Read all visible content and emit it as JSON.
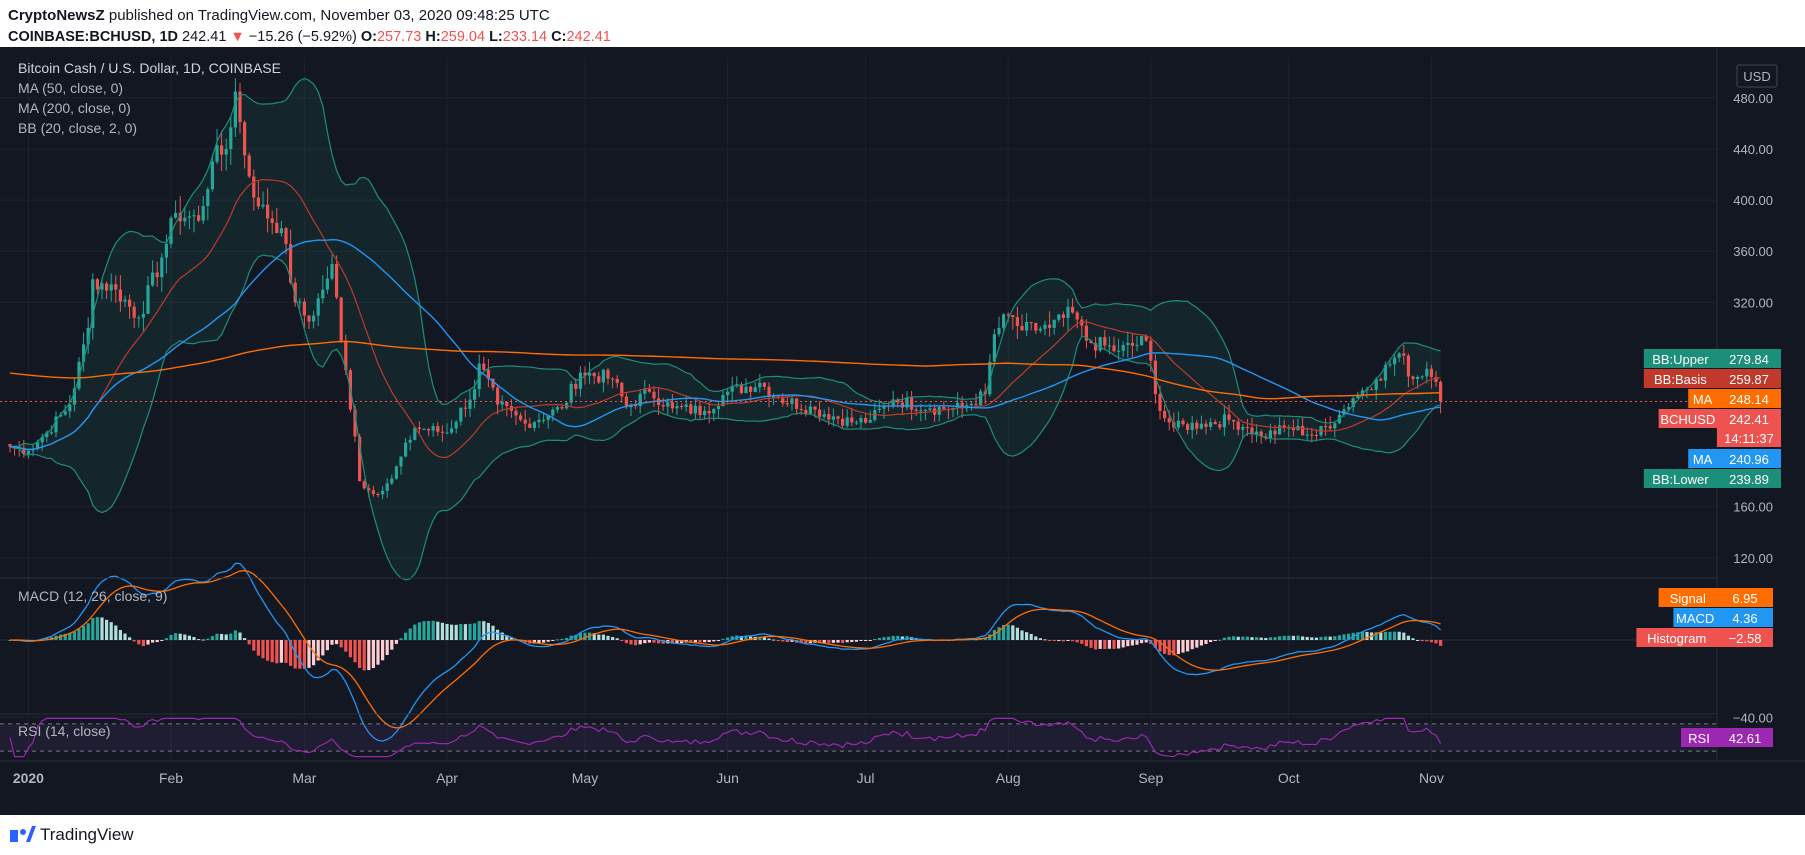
{
  "header": {
    "publisher": "CryptoNewsZ",
    "published_text": "published on TradingView.com, November 03, 2020 09:48:25 UTC",
    "symbol": "COINBASE:BCHUSD, 1D",
    "last": "242.41",
    "change_arrow": "▼",
    "change": "−15.26 (−5.92%)",
    "o_label": "O:",
    "o": "257.73",
    "h_label": "H:",
    "h": "259.04",
    "l_label": "L:",
    "l": "233.14",
    "c_label": "C:",
    "c": "242.41"
  },
  "legend": {
    "title": "Bitcoin Cash / U.S. Dollar, 1D, COINBASE",
    "ma50": "MA (50, close, 0)",
    "ma200": "MA (200, close, 0)",
    "bb": "BB (20, close, 2, 0)",
    "macd": "MACD (12, 26, close, 9)",
    "rsi": "RSI (14, close)"
  },
  "currency": "USD",
  "footer": {
    "brand": "TradingView"
  },
  "colors": {
    "background": "#131722",
    "up": "#26a69a",
    "down": "#ef5350",
    "ma50": "#2196f3",
    "ma200": "#ff6d00",
    "bb_bands": "#1b8f7a",
    "bb_basis": "#c0392b",
    "macd_line": "#2196f3",
    "signal_line": "#ff6d00",
    "rsi_line": "#9c27b0"
  },
  "chart_data": [
    {
      "type": "candlestick",
      "title": "Bitcoin Cash / U.S. Dollar, 1D, COINBASE",
      "ylim": [
        105,
        512
      ],
      "y_ticks": [
        "480.00",
        "440.00",
        "400.00",
        "360.00",
        "320.00",
        "160.00",
        "120.00"
      ],
      "x_ticks": [
        "2020",
        "Feb",
        "Mar",
        "Apr",
        "May",
        "Jun",
        "Jul",
        "Aug",
        "Sep",
        "Oct",
        "Nov"
      ],
      "x_dates": [
        "2019-12-28",
        "2020-11-03"
      ],
      "close_anchors": [
        [
          "2019-12-28",
          207
        ],
        [
          "2020-01-01",
          204
        ],
        [
          "2020-01-05",
          218
        ],
        [
          "2020-01-10",
          240
        ],
        [
          "2020-01-14",
          300
        ],
        [
          "2020-01-15",
          338
        ],
        [
          "2020-01-20",
          330
        ],
        [
          "2020-01-25",
          308
        ],
        [
          "2020-01-30",
          355
        ],
        [
          "2020-02-02",
          390
        ],
        [
          "2020-02-07",
          384
        ],
        [
          "2020-02-10",
          430
        ],
        [
          "2020-02-13",
          440
        ],
        [
          "2020-02-15",
          485
        ],
        [
          "2020-02-17",
          435
        ],
        [
          "2020-02-20",
          395
        ],
        [
          "2020-02-25",
          378
        ],
        [
          "2020-02-28",
          320
        ],
        [
          "2020-03-02",
          305
        ],
        [
          "2020-03-05",
          330
        ],
        [
          "2020-03-07",
          350
        ],
        [
          "2020-03-09",
          290
        ],
        [
          "2020-03-12",
          215
        ],
        [
          "2020-03-13",
          180
        ],
        [
          "2020-03-16",
          170
        ],
        [
          "2020-03-20",
          182
        ],
        [
          "2020-03-25",
          222
        ],
        [
          "2020-04-01",
          218
        ],
        [
          "2020-04-07",
          252
        ],
        [
          "2020-04-08",
          272
        ],
        [
          "2020-04-12",
          240
        ],
        [
          "2020-04-18",
          225
        ],
        [
          "2020-04-26",
          237
        ],
        [
          "2020-04-30",
          265
        ],
        [
          "2020-05-07",
          260
        ],
        [
          "2020-05-10",
          238
        ],
        [
          "2020-05-15",
          250
        ],
        [
          "2020-05-20",
          237
        ],
        [
          "2020-05-27",
          235
        ],
        [
          "2020-06-01",
          250
        ],
        [
          "2020-06-08",
          257
        ],
        [
          "2020-06-12",
          245
        ],
        [
          "2020-06-20",
          236
        ],
        [
          "2020-06-28",
          226
        ],
        [
          "2020-07-02",
          228
        ],
        [
          "2020-07-07",
          244
        ],
        [
          "2020-07-15",
          237
        ],
        [
          "2020-07-22",
          237
        ],
        [
          "2020-07-27",
          248
        ],
        [
          "2020-07-29",
          295
        ],
        [
          "2020-08-01",
          310
        ],
        [
          "2020-08-04",
          298
        ],
        [
          "2020-08-10",
          300
        ],
        [
          "2020-08-15",
          312
        ],
        [
          "2020-08-18",
          290
        ],
        [
          "2020-08-25",
          282
        ],
        [
          "2020-08-31",
          290
        ],
        [
          "2020-09-03",
          235
        ],
        [
          "2020-09-06",
          222
        ],
        [
          "2020-09-12",
          225
        ],
        [
          "2020-09-18",
          228
        ],
        [
          "2020-09-22",
          222
        ],
        [
          "2020-09-25",
          215
        ],
        [
          "2020-10-01",
          222
        ],
        [
          "2020-10-07",
          216
        ],
        [
          "2020-10-12",
          232
        ],
        [
          "2020-10-15",
          245
        ],
        [
          "2020-10-20",
          260
        ],
        [
          "2020-10-25",
          280
        ],
        [
          "2020-10-28",
          260
        ],
        [
          "2020-10-31",
          268
        ],
        [
          "2020-11-02",
          257.73
        ],
        [
          "2020-11-03",
          242.41
        ]
      ],
      "last": {
        "open": 257.73,
        "high": 259.04,
        "low": 233.14,
        "close": 242.41
      },
      "price_labels": [
        {
          "name": "BB:Upper",
          "value": "279.84",
          "color": "#1b8f7a"
        },
        {
          "name": "BB:Basis",
          "value": "259.87",
          "color": "#c0392b"
        },
        {
          "name": "MA",
          "value": "248.14",
          "color": "#ff6d00"
        },
        {
          "name": "BCHUSD",
          "value": "242.41",
          "color": "#ef5350"
        },
        {
          "name": "",
          "value": "14:11:37",
          "color": "#ef5350"
        },
        {
          "name": "MA",
          "value": "240.96",
          "color": "#2196f3"
        },
        {
          "name": "BB:Lower",
          "value": "239.89",
          "color": "#1b8f7a"
        }
      ]
    },
    {
      "type": "macd",
      "title": "MACD (12, 26, close, 9)",
      "y_ticks": [
        "−40.00"
      ],
      "values": [
        {
          "name": "Signal",
          "value": "6.95",
          "color": "#ff6d00"
        },
        {
          "name": "MACD",
          "value": "4.36",
          "color": "#2196f3"
        },
        {
          "name": "Histogram",
          "value": "−2.58",
          "color": "#ef5350"
        }
      ]
    },
    {
      "type": "rsi",
      "title": "RSI (14, close)",
      "values": [
        {
          "name": "RSI",
          "value": "42.61",
          "color": "#9c27b0"
        }
      ]
    }
  ]
}
